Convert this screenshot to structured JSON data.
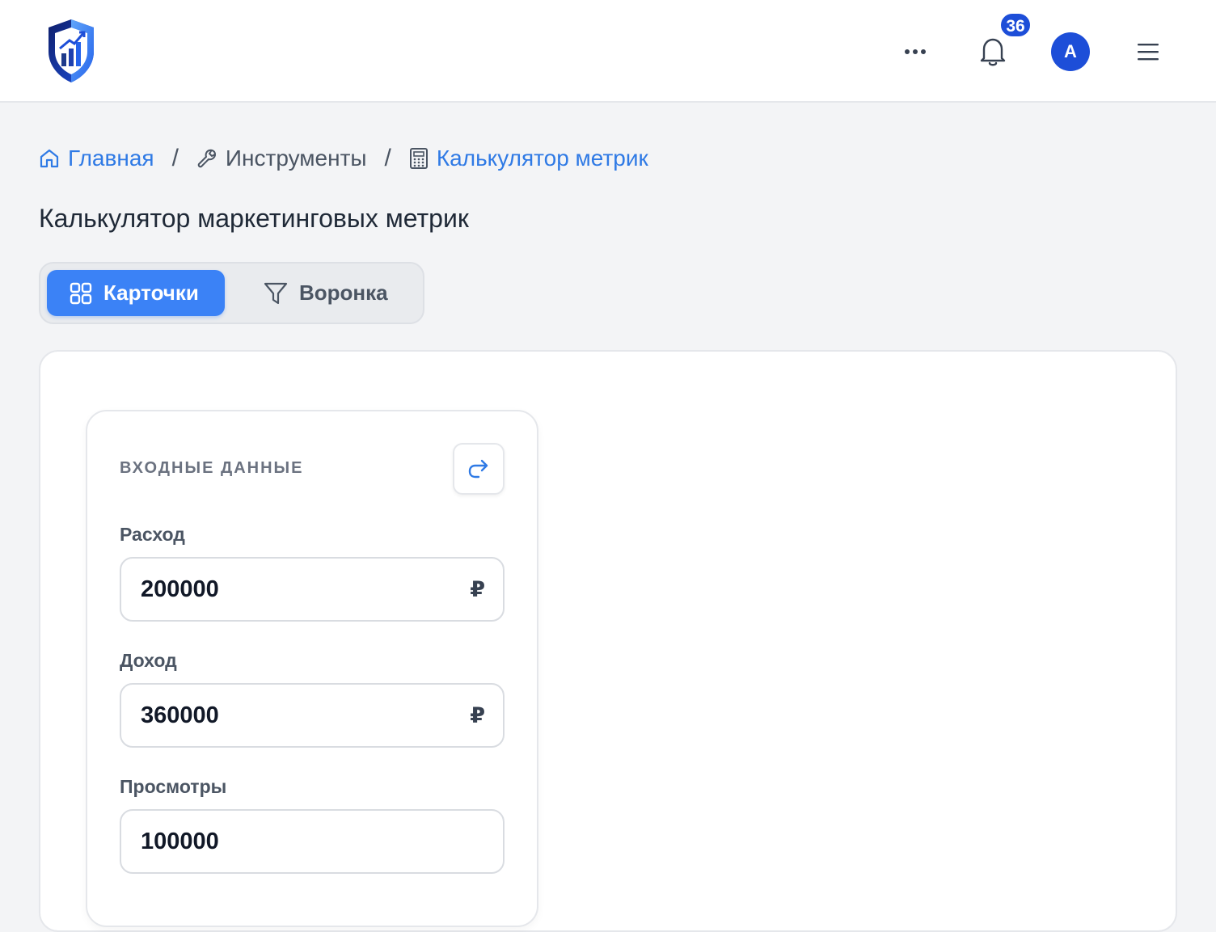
{
  "header": {
    "notification_count": "36",
    "avatar_initial": "A",
    "brand_color": "#1d4ed8"
  },
  "breadcrumb": {
    "home": "Главная",
    "tools": "Инструменты",
    "current": "Калькулятор метрик",
    "separator": "/"
  },
  "page": {
    "title": "Калькулятор маркетинговых метрик"
  },
  "tabs": [
    {
      "label": "Карточки",
      "icon": "grid-icon",
      "active": true
    },
    {
      "label": "Воронка",
      "icon": "funnel-icon",
      "active": false
    }
  ],
  "input_section": {
    "title": "ВХОДНЫЕ ДАННЫЕ",
    "fields": [
      {
        "label": "Расход",
        "value": "200000",
        "unit": "₽"
      },
      {
        "label": "Доход",
        "value": "360000",
        "unit": "₽"
      },
      {
        "label": "Просмотры",
        "value": "100000",
        "unit": ""
      }
    ]
  },
  "colors": {
    "accent": "#3b82f6",
    "link": "#2f7ae5",
    "background": "#f3f4f6"
  }
}
